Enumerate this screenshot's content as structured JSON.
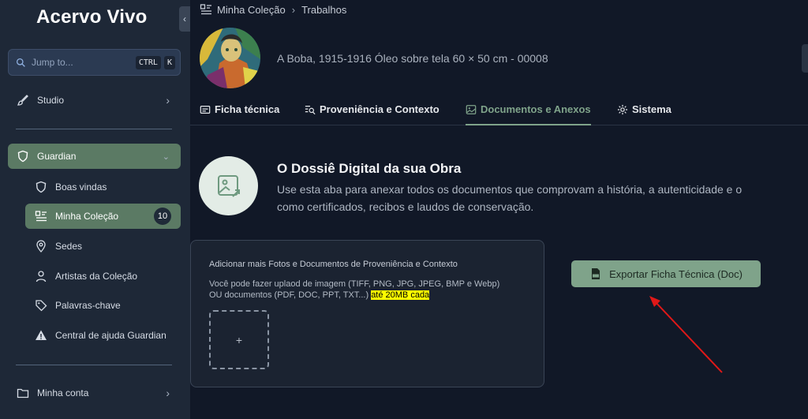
{
  "app": {
    "title": "Acervo Vivo"
  },
  "search": {
    "placeholder": "Jump to...",
    "shortcut_ctrl": "CTRL",
    "shortcut_key": "K"
  },
  "sidebar": {
    "studio": "Studio",
    "guardian": "Guardian",
    "guardian_items": [
      {
        "label": "Boas vindas",
        "icon": "shield-icon"
      },
      {
        "label": "Minha Coleção",
        "icon": "list-icon",
        "badge": "10"
      },
      {
        "label": "Sedes",
        "icon": "map-pin-icon"
      },
      {
        "label": "Artistas da Coleção",
        "icon": "user-icon"
      },
      {
        "label": "Palavras-chave",
        "icon": "tag-icon"
      },
      {
        "label": "Central de ajuda Guardian",
        "icon": "warning-icon"
      }
    ],
    "account": "Minha conta"
  },
  "breadcrumb": {
    "first": "Minha Coleção",
    "second": "Trabalhos"
  },
  "artwork": {
    "title": "A Boba, 1915-1916 Óleo sobre tela 60 × 50 cm - 00008"
  },
  "tabs": [
    {
      "label": "Ficha técnica"
    },
    {
      "label": "Proveniência e Contexto"
    },
    {
      "label": "Documentos e Anexos"
    },
    {
      "label": "Sistema"
    }
  ],
  "dossier": {
    "title": "O Dossiê Digital da sua Obra",
    "desc_line1": "Use esta aba para anexar todos os documentos que comprovam a história, a autenticidade e o",
    "desc_line2": "como certificados, recibos e laudos de conservação."
  },
  "upload": {
    "title": "Adicionar mais Fotos e Documentos de Proveniência e Contexto",
    "desc_line1": "Você pode fazer uplaod de imagem (TIFF, PNG, JPG, JPEG, BMP e Webp)",
    "desc_line2": "OU documentos (PDF, DOC, PPT, TXT...)",
    "desc_highlight": "até 20MB cada",
    "add_symbol": "+"
  },
  "export": {
    "label": "Exportar Ficha Técnica (Doc)"
  },
  "colors": {
    "accent": "#7fa38a",
    "sidebar_active": "#5b7a64",
    "highlight": "#ffff00",
    "annotation_arrow": "#e01818"
  }
}
